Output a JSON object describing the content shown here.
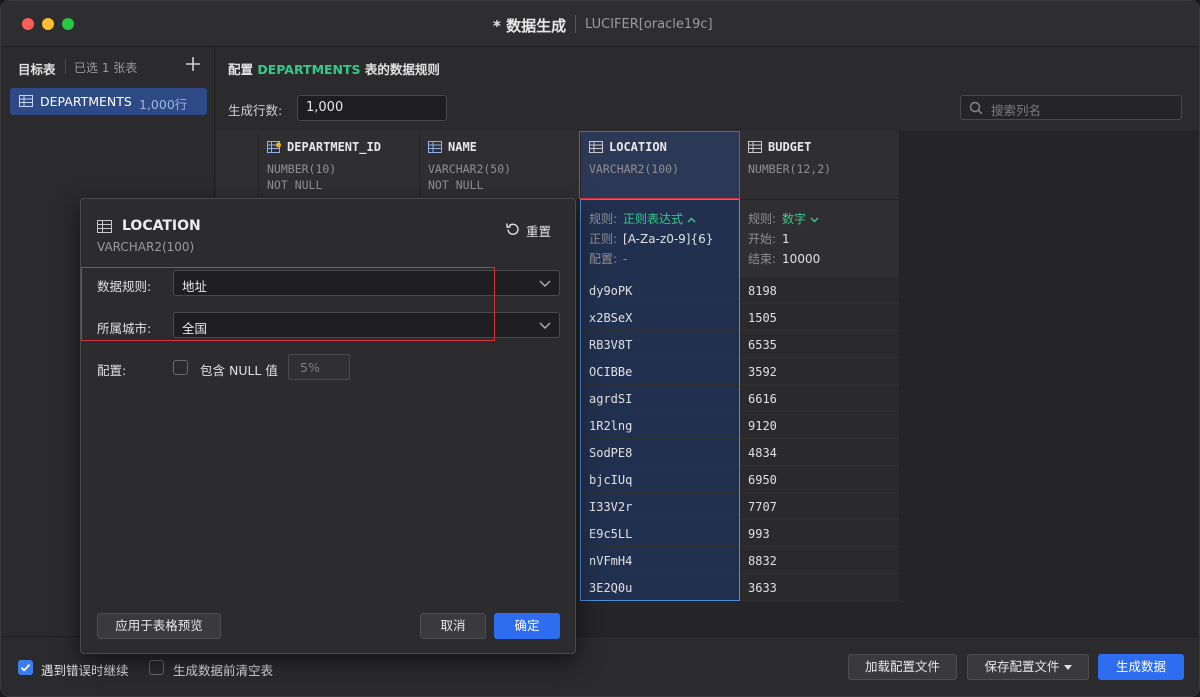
{
  "window": {
    "title": "* 数据生成",
    "subtitle": "LUCIFER[oracle19c]"
  },
  "sidebar": {
    "title": "目标表",
    "selected_count": "已选 1 张表",
    "items": [
      {
        "name": "DEPARTMENTS",
        "rows": "1,000行"
      }
    ]
  },
  "config": {
    "title_prefix": "配置",
    "table_name": "DEPARTMENTS",
    "title_suffix": "表的数据规则",
    "rows_label": "生成行数:",
    "rows_value": "1,000",
    "search_placeholder": "搜索列名"
  },
  "columns": [
    {
      "name": "DEPARTMENT_ID",
      "type": "NUMBER(10)",
      "constraint": "NOT NULL"
    },
    {
      "name": "NAME",
      "type": "VARCHAR2(50)",
      "constraint": "NOT NULL"
    },
    {
      "name": "LOCATION",
      "type": "VARCHAR2(100)",
      "constraint": "",
      "rule_label": "规则:",
      "rule": "正则表达式",
      "pattern_label": "正则:",
      "pattern": "[A-Za-z0-9]{6}",
      "config_label": "配置:",
      "config": "-"
    },
    {
      "name": "BUDGET",
      "type": "NUMBER(12,2)",
      "constraint": "",
      "rule_label": "规则:",
      "rule": "数字",
      "start_label": "开始:",
      "start": "1",
      "end_label": "结束:",
      "end": "10000"
    }
  ],
  "rows": {
    "location": [
      "dy9oPK",
      "x2BSeX",
      "RB3V8T",
      "OCIBBe",
      "agrdSI",
      "1R2lng",
      "SodPE8",
      "bjcIUq",
      "I33V2r",
      "E9c5LL",
      "nVFmH4",
      "3E2Q0u"
    ],
    "budget": [
      "8198",
      "1505",
      "6535",
      "3592",
      "6616",
      "9120",
      "4834",
      "6950",
      "7707",
      "993",
      "8832",
      "3633"
    ]
  },
  "dialog": {
    "title": "LOCATION",
    "type": "VARCHAR2(100)",
    "reset": "重置",
    "rule_label": "数据规则:",
    "rule_value": "地址",
    "city_label": "所属城市:",
    "city_value": "全国",
    "config_label": "配置:",
    "include_null": "包含 NULL 值",
    "null_pct": "5%",
    "apply_preview": "应用于表格预览",
    "cancel": "取消",
    "ok": "确定"
  },
  "footer": {
    "continue_on_error": "遇到错误时继续",
    "continue_on_error_checked": true,
    "clear_before": "生成数据前清空表",
    "clear_before_checked": false,
    "load_config": "加载配置文件",
    "save_config": "保存配置文件",
    "generate": "生成数据"
  },
  "colors": {
    "accent_green": "#35c98a",
    "primary_blue": "#2f6df0",
    "selection": "#2d4a86",
    "highlight_red": "#d8323c"
  }
}
